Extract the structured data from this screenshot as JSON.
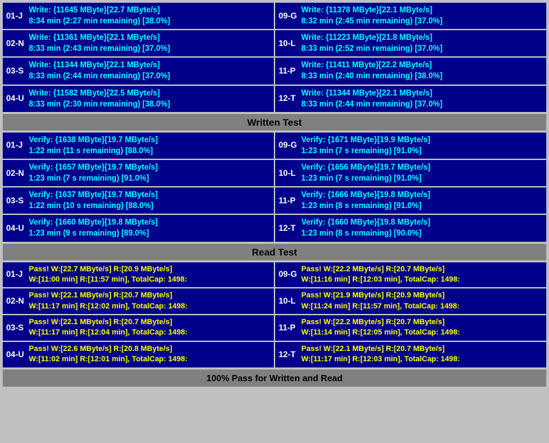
{
  "sections": {
    "write": {
      "label": "Written Test",
      "rows": [
        {
          "left": {
            "id": "01-J",
            "line1": "Write: {11645 MByte}[22.7 MByte/s]",
            "line2": "8:34 min (2:27 min remaining)  [38.0%]"
          },
          "right": {
            "id": "09-G",
            "line1": "Write: {11378 MByte}[22.1 MByte/s]",
            "line2": "8:32 min (2:45 min remaining)  [37.0%]"
          }
        },
        {
          "left": {
            "id": "02-N",
            "line1": "Write: {11361 MByte}[22.1 MByte/s]",
            "line2": "8:33 min (2:43 min remaining)  [37.0%]"
          },
          "right": {
            "id": "10-L",
            "line1": "Write: {11223 MByte}[21.8 MByte/s]",
            "line2": "8:33 min (2:52 min remaining)  [37.0%]"
          }
        },
        {
          "left": {
            "id": "03-S",
            "line1": "Write: {11344 MByte}[22.1 MByte/s]",
            "line2": "8:33 min (2:44 min remaining)  [37.0%]"
          },
          "right": {
            "id": "11-P",
            "line1": "Write: {11411 MByte}[22.2 MByte/s]",
            "line2": "8:33 min (2:40 min remaining)  [38.0%]"
          }
        },
        {
          "left": {
            "id": "04-U",
            "line1": "Write: {11582 MByte}[22.5 MByte/s]",
            "line2": "8:33 min (2:30 min remaining)  [38.0%]"
          },
          "right": {
            "id": "12-T",
            "line1": "Write: {11344 MByte}[22.1 MByte/s]",
            "line2": "8:33 min (2:44 min remaining)  [37.0%]"
          }
        }
      ]
    },
    "verify": {
      "label": "Written Test",
      "rows": [
        {
          "left": {
            "id": "01-J",
            "line1": "Verify: {1638 MByte}[19.7 MByte/s]",
            "line2": "1:22 min (11 s remaining)  [88.0%]"
          },
          "right": {
            "id": "09-G",
            "line1": "Verify: {1671 MByte}[19.9 MByte/s]",
            "line2": "1:23 min (7 s remaining)  [91.0%]"
          }
        },
        {
          "left": {
            "id": "02-N",
            "line1": "Verify: {1657 MByte}[19.7 MByte/s]",
            "line2": "1:23 min (7 s remaining)  [91.0%]"
          },
          "right": {
            "id": "10-L",
            "line1": "Verify: {1656 MByte}[19.7 MByte/s]",
            "line2": "1:23 min (7 s remaining)  [91.0%]"
          }
        },
        {
          "left": {
            "id": "03-S",
            "line1": "Verify: {1637 MByte}[19.7 MByte/s]",
            "line2": "1:22 min (10 s remaining)  [88.0%]"
          },
          "right": {
            "id": "11-P",
            "line1": "Verify: {1666 MByte}[19.8 MByte/s]",
            "line2": "1:23 min (8 s remaining)  [91.0%]"
          }
        },
        {
          "left": {
            "id": "04-U",
            "line1": "Verify: {1660 MByte}[19.8 MByte/s]",
            "line2": "1:23 min (9 s remaining)  [89.0%]"
          },
          "right": {
            "id": "12-T",
            "line1": "Verify: {1660 MByte}[19.8 MByte/s]",
            "line2": "1:23 min (8 s remaining)  [90.0%]"
          }
        }
      ]
    },
    "read": {
      "label": "Read Test",
      "rows": [
        {
          "left": {
            "id": "01-J",
            "line1": "Pass! W:[22.7 MByte/s] R:[20.9 MByte/s]",
            "line2": "W:[11:00 min] R:[11:57 min], TotalCap: 1498:"
          },
          "right": {
            "id": "09-G",
            "line1": "Pass! W:[22.2 MByte/s] R:[20.7 MByte/s]",
            "line2": "W:[11:16 min] R:[12:03 min], TotalCap: 1498:"
          }
        },
        {
          "left": {
            "id": "02-N",
            "line1": "Pass! W:[22.1 MByte/s] R:[20.7 MByte/s]",
            "line2": "W:[11:17 min] R:[12:02 min], TotalCap: 1498:"
          },
          "right": {
            "id": "10-L",
            "line1": "Pass! W:[21.9 MByte/s] R:[20.9 MByte/s]",
            "line2": "W:[11:24 min] R:[11:57 min], TotalCap: 1498:"
          }
        },
        {
          "left": {
            "id": "03-S",
            "line1": "Pass! W:[22.1 MByte/s] R:[20.7 MByte/s]",
            "line2": "W:[11:17 min] R:[12:04 min], TotalCap: 1498:"
          },
          "right": {
            "id": "11-P",
            "line1": "Pass! W:[22.2 MByte/s] R:[20.7 MByte/s]",
            "line2": "W:[11:14 min] R:[12:05 min], TotalCap: 1498:"
          }
        },
        {
          "left": {
            "id": "04-U",
            "line1": "Pass! W:[22.6 MByte/s] R:[20.8 MByte/s]",
            "line2": "W:[11:02 min] R:[12:01 min], TotalCap: 1498:"
          },
          "right": {
            "id": "12-T",
            "line1": "Pass! W:[22.1 MByte/s] R:[20.7 MByte/s]",
            "line2": "W:[11:17 min] R:[12:03 min], TotalCap: 1498:"
          }
        }
      ]
    }
  },
  "labels": {
    "written_test": "Written Test",
    "read_test": "Read Test",
    "footer": "100% Pass for Written and Read"
  }
}
